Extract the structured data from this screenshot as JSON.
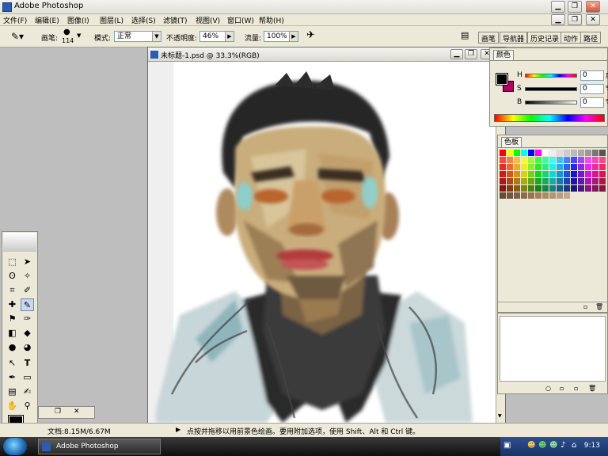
{
  "window": {
    "title": "Adobe Photoshop"
  },
  "menu": [
    "文件(F)",
    "编辑(E)",
    "图像(I)",
    "图层(L)",
    "选择(S)",
    "滤镜(T)",
    "视图(V)",
    "窗口(W)",
    "帮助(H)"
  ],
  "options": {
    "brush_label": "画笔:",
    "brush_size": "114",
    "mode_label": "模式:",
    "mode_value": "正常",
    "opacity_label": "不透明度:",
    "opacity_value": "46%",
    "flow_label": "流量:",
    "flow_value": "100%"
  },
  "panel_tabs": [
    "画笔",
    "导航器",
    "历史记录",
    "动作",
    "路径"
  ],
  "document": {
    "title": "未标题-1.psd @ 33.3%(RGB)"
  },
  "color_panel": {
    "tab": "颜色",
    "h_label": "H",
    "h_value": "0",
    "h_unit": "度",
    "s_label": "S",
    "s_value": "0",
    "s_unit": "%",
    "b_label": "B",
    "b_value": "0",
    "b_unit": "%",
    "foreground": "#000000",
    "background": "#b0006a"
  },
  "swatch_panel": {
    "tab": "色板"
  },
  "status": {
    "doc_info": "文档:8.15M/6.67M",
    "hint": "点按并拖移以用前景色绘画。要用附加选项，使用 Shift、Alt 和 Ctrl 键。"
  },
  "taskbar": {
    "item": "Adobe Photoshop",
    "clock": "9:13"
  }
}
